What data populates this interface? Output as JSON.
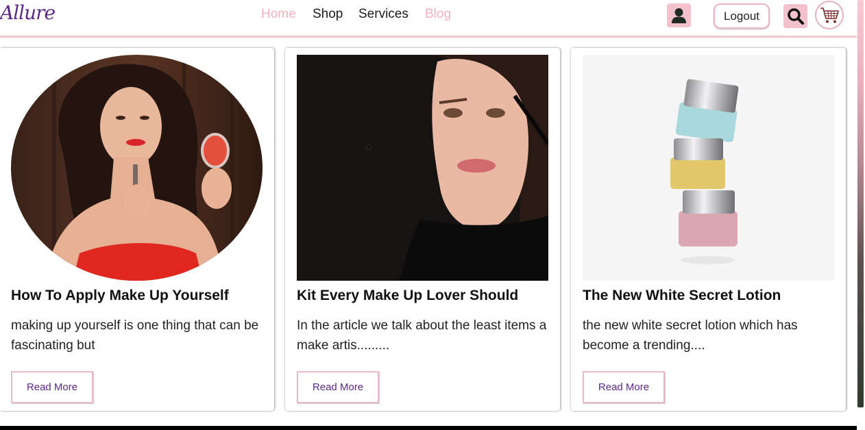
{
  "header": {
    "logo": "Allure",
    "nav": [
      {
        "label": "Home",
        "active": true
      },
      {
        "label": "Shop",
        "active": false
      },
      {
        "label": "Services",
        "active": false
      },
      {
        "label": "Blog",
        "active": true
      }
    ],
    "logout_label": "Logout",
    "icons": {
      "user": "user-icon",
      "search": "search-icon",
      "cart": "cart-icon"
    }
  },
  "cards": [
    {
      "title": "How To Apply Make Up Yourself",
      "text": "making up yourself is one thing that can be fascinating but",
      "button": "Read More",
      "image": "woman-applying-lipstick-photo"
    },
    {
      "title": "Kit Every Make Up Lover Should",
      "text": "In the article we talk about the least items a make artis.........",
      "button": "Read More",
      "image": "woman-applying-mascara-photo"
    },
    {
      "title": "The New White Secret Lotion",
      "text": "the new white secret lotion which has become a trending....",
      "button": "Read More",
      "image": "stacked-cosmetic-jars-photo"
    }
  ],
  "colors": {
    "brand_purple": "#5b2a86",
    "accent_pink": "#f3c2cd",
    "nav_active_pink": "#f0b2c1",
    "border_pink": "#e9b8c4"
  }
}
